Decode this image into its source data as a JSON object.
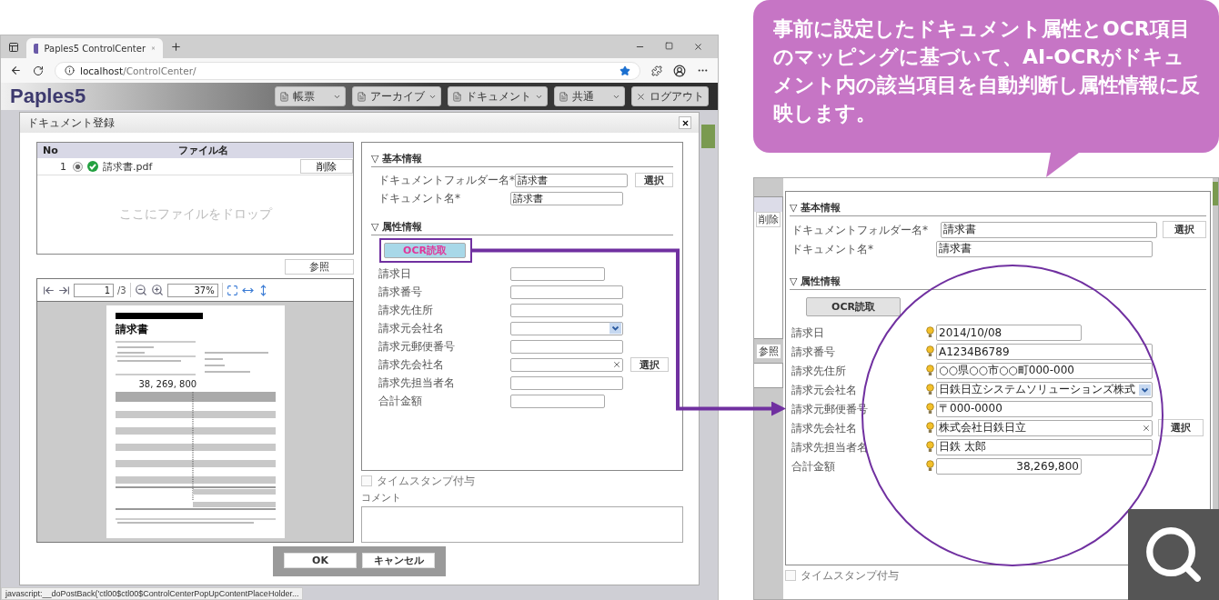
{
  "browser": {
    "tab_title": "Paples5 ControlCenter",
    "url_host": "localhost",
    "url_path": "/ControlCenter/",
    "status_text": "javascript:__doPostBack('ctl00$ctl00$ControlCenterPopUpContentPlaceHolder..."
  },
  "app_header": {
    "logo": "Paples5",
    "menus": [
      {
        "label": "帳票",
        "kind": "dropdown"
      },
      {
        "label": "アーカイブ",
        "kind": "dropdown"
      },
      {
        "label": "ドキュメント",
        "kind": "dropdown"
      },
      {
        "label": "共通",
        "kind": "dropdown"
      },
      {
        "label": "ログアウト",
        "kind": "logout"
      }
    ]
  },
  "dialog": {
    "title": "ドキュメント登録",
    "files": {
      "columns": [
        "No",
        "ファイル名"
      ],
      "rows": [
        {
          "no": "1",
          "name": "請求書.pdf",
          "selected": true,
          "action": "削除"
        }
      ],
      "drop_hint": "ここにファイルをドロップ"
    },
    "browse_button": "参照",
    "viewer": {
      "page": "1",
      "page_count": "/3",
      "zoom": "37%",
      "document": {
        "title": "請求書",
        "amount": "38, 269, 800"
      }
    },
    "form": {
      "basic": {
        "heading": "▽ 基本情報",
        "fields": [
          {
            "label": "ドキュメントフォルダー名*",
            "value": "請求書",
            "kind": "text",
            "ocr": false,
            "button": "選択"
          },
          {
            "label": "ドキュメント名*",
            "value": "請求書",
            "kind": "text",
            "ocr": false
          }
        ]
      },
      "attributes": {
        "heading": "▽ 属性情報",
        "ocr_button": {
          "label": "OCR読取",
          "highlighted": true
        },
        "fields": [
          {
            "label": "請求日",
            "kind": "short",
            "ocr": false
          },
          {
            "label": "請求番号",
            "kind": "text",
            "ocr": false
          },
          {
            "label": "請求先住所",
            "kind": "text",
            "ocr": false
          },
          {
            "label": "請求元会社名",
            "kind": "select",
            "ocr": false
          },
          {
            "label": "請求元郵便番号",
            "kind": "text",
            "ocr": false
          },
          {
            "label": "請求先会社名",
            "kind": "clearable",
            "ocr": false,
            "button": "選択"
          },
          {
            "label": "請求先担当者名",
            "kind": "text",
            "ocr": false
          },
          {
            "label": "合計金額",
            "kind": "short",
            "ocr": false
          }
        ]
      },
      "timestamp": {
        "label": "タイムスタンプ付与",
        "checked": false
      }
    },
    "comment_label": "コメント",
    "buttons": [
      {
        "label": "OK"
      },
      {
        "label": "キャンセル"
      }
    ]
  },
  "callout": {
    "text": "事前に設定したドキュメント属性とOCR項目のマッピングに基づいて、AI-OCRがドキュメント内の該当項目を自動判断し属性情報に反映します。"
  },
  "zoom_view": {
    "delete_button": "削除",
    "browse_button": "参照",
    "form": {
      "basic": {
        "heading": "▽ 基本情報",
        "fields": [
          {
            "label": "ドキュメントフォルダー名*",
            "value": "請求書",
            "kind": "text",
            "ocr": false,
            "button": "選択"
          },
          {
            "label": "ドキュメント名*",
            "value": "請求書",
            "kind": "text",
            "ocr": false
          }
        ]
      },
      "attributes": {
        "heading": "▽ 属性情報",
        "ocr_button": {
          "label": "OCR読取",
          "highlighted": false
        },
        "fields": [
          {
            "label": "請求日",
            "value": "2014/10/08",
            "kind": "short",
            "ocr": true
          },
          {
            "label": "請求番号",
            "value": "A1234B6789",
            "kind": "text",
            "ocr": true
          },
          {
            "label": "請求先住所",
            "value": "○○県○○市○○町000-000",
            "kind": "text",
            "ocr": true
          },
          {
            "label": "請求元会社名",
            "value": "日鉄日立システムソリューションズ株式",
            "kind": "select",
            "ocr": true
          },
          {
            "label": "請求元郵便番号",
            "value": "〒000-0000",
            "kind": "text",
            "ocr": true
          },
          {
            "label": "請求先会社名",
            "value": "株式会社日鉄日立",
            "kind": "clearable",
            "ocr": true,
            "button": "選択"
          },
          {
            "label": "請求先担当者名",
            "value": "日鉄 太郎",
            "kind": "text",
            "ocr": true
          },
          {
            "label": "合計金額",
            "value": "38,269,800",
            "kind": "amount",
            "ocr": true
          }
        ]
      },
      "timestamp": {
        "label": "タイムスタンプ付与",
        "checked": false
      }
    }
  }
}
